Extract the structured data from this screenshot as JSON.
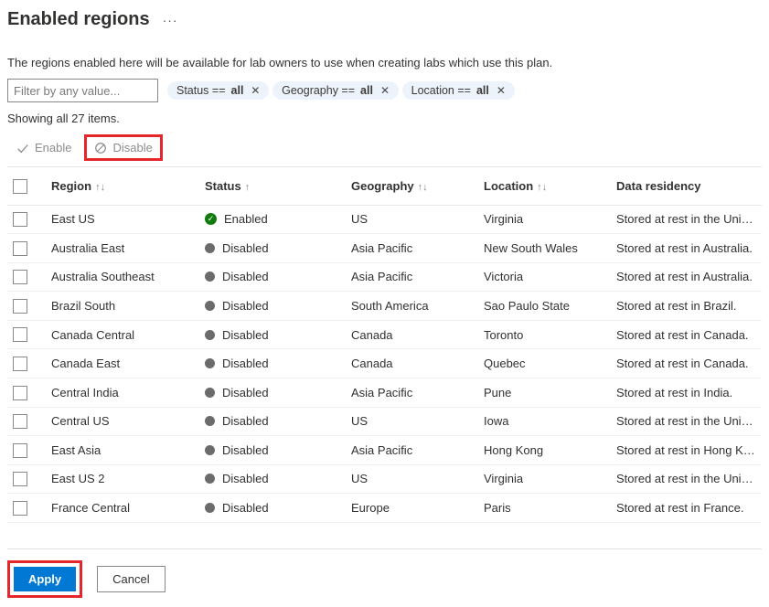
{
  "header": {
    "title": "Enabled regions"
  },
  "description": "The regions enabled here will be available for lab owners to use when creating labs which use this plan.",
  "filter": {
    "input_placeholder": "Filter by any value...",
    "pills": [
      {
        "label": "Status == ",
        "value": "all"
      },
      {
        "label": "Geography == ",
        "value": "all"
      },
      {
        "label": "Location == ",
        "value": "all"
      }
    ]
  },
  "showing_text": "Showing all 27 items.",
  "actions": {
    "enable_label": "Enable",
    "disable_label": "Disable"
  },
  "columns": {
    "region": "Region",
    "status": "Status",
    "geography": "Geography",
    "location": "Location",
    "residency": "Data residency"
  },
  "rows": [
    {
      "region": "East US",
      "status": "Enabled",
      "enabled": true,
      "geography": "US",
      "location": "Virginia",
      "residency": "Stored at rest in the United States."
    },
    {
      "region": "Australia East",
      "status": "Disabled",
      "enabled": false,
      "geography": "Asia Pacific",
      "location": "New South Wales",
      "residency": "Stored at rest in Australia."
    },
    {
      "region": "Australia Southeast",
      "status": "Disabled",
      "enabled": false,
      "geography": "Asia Pacific",
      "location": "Victoria",
      "residency": "Stored at rest in Australia."
    },
    {
      "region": "Brazil South",
      "status": "Disabled",
      "enabled": false,
      "geography": "South America",
      "location": "Sao Paulo State",
      "residency": "Stored at rest in Brazil."
    },
    {
      "region": "Canada Central",
      "status": "Disabled",
      "enabled": false,
      "geography": "Canada",
      "location": "Toronto",
      "residency": "Stored at rest in Canada."
    },
    {
      "region": "Canada East",
      "status": "Disabled",
      "enabled": false,
      "geography": "Canada",
      "location": "Quebec",
      "residency": "Stored at rest in Canada."
    },
    {
      "region": "Central India",
      "status": "Disabled",
      "enabled": false,
      "geography": "Asia Pacific",
      "location": "Pune",
      "residency": "Stored at rest in India."
    },
    {
      "region": "Central US",
      "status": "Disabled",
      "enabled": false,
      "geography": "US",
      "location": "Iowa",
      "residency": "Stored at rest in the United States."
    },
    {
      "region": "East Asia",
      "status": "Disabled",
      "enabled": false,
      "geography": "Asia Pacific",
      "location": "Hong Kong",
      "residency": "Stored at rest in Hong Kong."
    },
    {
      "region": "East US 2",
      "status": "Disabled",
      "enabled": false,
      "geography": "US",
      "location": "Virginia",
      "residency": "Stored at rest in the United States."
    },
    {
      "region": "France Central",
      "status": "Disabled",
      "enabled": false,
      "geography": "Europe",
      "location": "Paris",
      "residency": "Stored at rest in France."
    }
  ],
  "footer": {
    "apply_label": "Apply",
    "cancel_label": "Cancel"
  }
}
